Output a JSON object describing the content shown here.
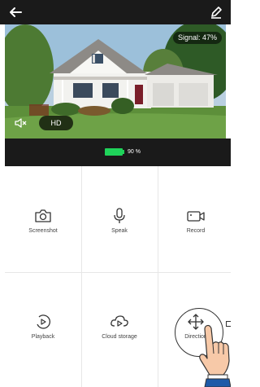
{
  "header": {
    "back_icon": "arrow-left-icon",
    "edit_icon": "pencil-icon"
  },
  "video": {
    "signal_text": "Signal: 47%",
    "quality": "HD",
    "mute_icon": "speaker-muted-icon"
  },
  "status": {
    "battery_percent": 90,
    "battery_text": "90 %"
  },
  "actions": [
    {
      "label": "Screenshot",
      "icon": "camera-icon"
    },
    {
      "label": "Speak",
      "icon": "microphone-icon"
    },
    {
      "label": "Record",
      "icon": "video-camera-icon"
    },
    {
      "label": "Playback",
      "icon": "playback-icon"
    },
    {
      "label": "Cloud storage",
      "icon": "cloud-play-icon"
    },
    {
      "label": "Direction",
      "icon": "move-arrows-icon"
    }
  ],
  "colors": {
    "battery": "#1fd35a",
    "dark_bar": "#1a1a1a"
  }
}
